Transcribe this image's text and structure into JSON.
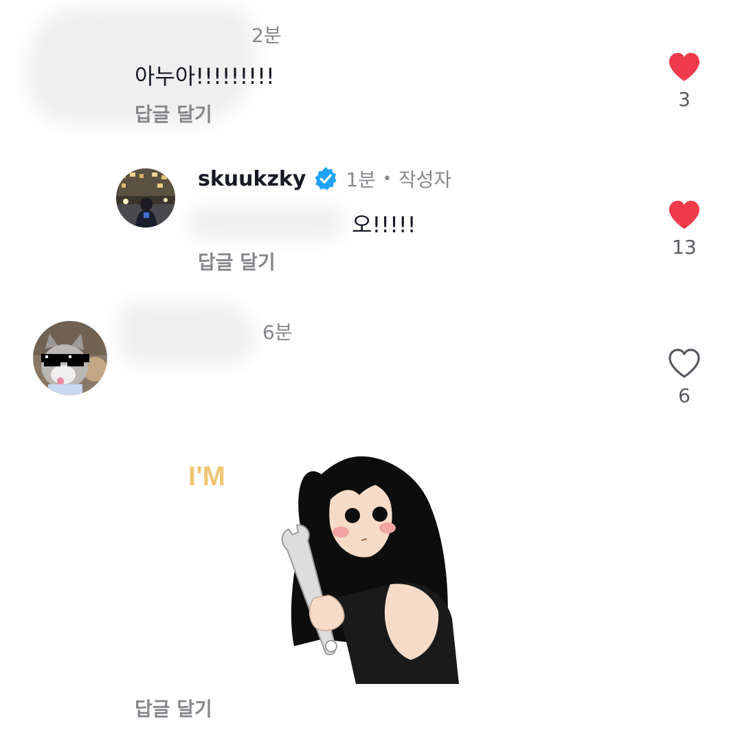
{
  "comments": [
    {
      "time": "2분",
      "text": "아누아!!!!!!!!!",
      "reply_label": "답글 달기",
      "likes": "3",
      "liked": true
    },
    {
      "username": "skuukzky",
      "time": "1분",
      "separator": "•",
      "author_badge": "작성자",
      "text": "오!!!!!",
      "reply_label": "답글 달기",
      "likes": "13",
      "liked": true
    },
    {
      "time": "6분",
      "sticker_text": "I'M",
      "reply_label": "답글 달기",
      "likes": "6",
      "liked": false
    }
  ],
  "colors": {
    "like_red": "#ee3a4a",
    "verified_blue": "#20a2f5",
    "muted": "#86878b"
  }
}
